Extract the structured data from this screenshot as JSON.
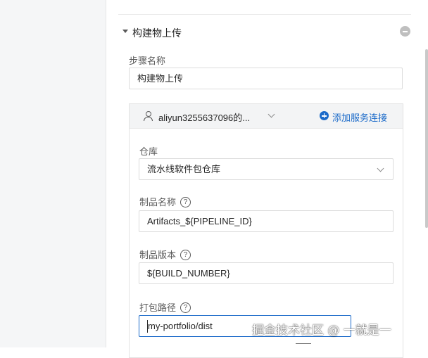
{
  "section": {
    "title": "构建物上传"
  },
  "step_name": {
    "label": "步骤名称",
    "value": "构建物上传"
  },
  "service_connection": {
    "account": "aliyun3255637096的...",
    "add_label": "添加服务连接"
  },
  "repository": {
    "label": "仓库",
    "value": "流水线软件包仓库"
  },
  "artifact_name": {
    "label": "制品名称",
    "help": "?",
    "value": "Artifacts_${PIPELINE_ID}"
  },
  "artifact_version": {
    "label": "制品版本",
    "help": "?",
    "value": "${BUILD_NUMBER}"
  },
  "package_path": {
    "label": "打包路径",
    "help": "?",
    "value": "my-portfolio/dist"
  },
  "watermark": "掘金技术社区 @ 一就是一",
  "colors": {
    "accent": "#1b6ac9",
    "border": "#dcdcdc",
    "panel_bg": "#f5f6f7"
  }
}
